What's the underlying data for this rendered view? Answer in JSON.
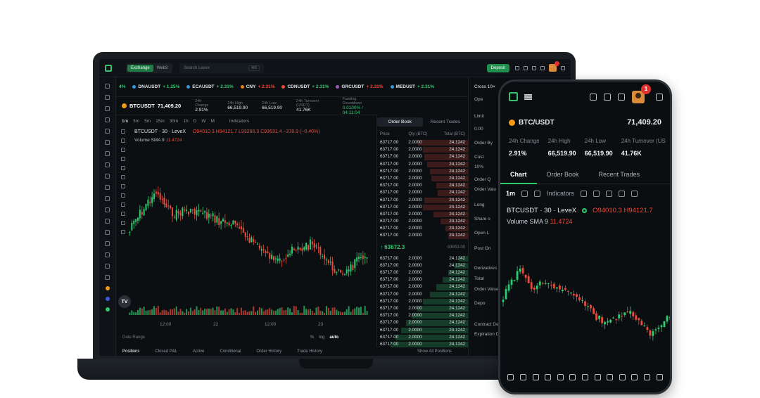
{
  "laptop": {
    "topbar": {
      "modes": [
        "Exchange",
        "Web3"
      ],
      "search_placeholder": "Search Levex",
      "search_shortcut": "⌘K",
      "deposit_label": "Deposit"
    },
    "tickers": [
      {
        "prefix": "4%",
        "symbol": "",
        "change": ""
      },
      {
        "symbol": "DNAUSDT",
        "change": "+ 1.25%",
        "color": "#3498db"
      },
      {
        "symbol": "ECAUSDT",
        "change": "+ 2.31%",
        "color": "#3498db"
      },
      {
        "symbol": "CNY",
        "change": "+ 2.31%",
        "color": "#e67e22"
      },
      {
        "symbol": "CDNUSDT",
        "change": "+ 2.31%",
        "color": "#e74c3c"
      },
      {
        "symbol": "GRCUSDT",
        "change": "+ 2.31%",
        "color": "#9b59b6"
      },
      {
        "symbol": "MEDUST",
        "change": "+ 2.31%",
        "color": "#3498db"
      }
    ],
    "pair": {
      "name": "BTCUSDT",
      "price": "71,409.20",
      "stats": [
        {
          "label": "24h Change",
          "value": "2.91%"
        },
        {
          "label": "24h High",
          "value": "66,519.90"
        },
        {
          "label": "24h Low",
          "value": "66,519.90"
        },
        {
          "label": "24h Turnover (USDT)",
          "value": "41.76K"
        },
        {
          "label": "Funding Countdown",
          "value": "0.0100% / 04:11:04"
        }
      ]
    },
    "timeframes": [
      "1m",
      "3m",
      "5m",
      "15m",
      "30m",
      "1h",
      "D",
      "W",
      "M"
    ],
    "indicators_label": "Indicators",
    "chart": {
      "title": "BTCUSDT · 30 · LeveX",
      "ohlc": "O94010.3  H94121.7  L93266.3  C93631.4  −378.9 (−0.40%)",
      "volume_label": "Volume SMA 9",
      "volume_value": "11.4724",
      "x_ticks": [
        "12:00",
        "22",
        "12:00",
        "23"
      ],
      "date_range_label": "Date Range",
      "scale_opts": [
        "%",
        "log",
        "auto"
      ]
    },
    "bottom_tabs": [
      "Positions",
      "Closed P&L",
      "Active",
      "Conditional",
      "Order History",
      "Trade History"
    ],
    "show_all_label": "Show All Positions",
    "orderbook": {
      "tabs": [
        "Order Book",
        "Recent Trades"
      ],
      "headers": [
        "Price",
        "Qty (BTC)",
        "Total (BTC)"
      ],
      "asks": [
        {
          "price": "63717.00",
          "qty": "2.0000",
          "total": "24.1242",
          "depth": 0.55
        },
        {
          "price": "63717.00",
          "qty": "2.0000",
          "total": "24.1242",
          "depth": 0.5
        },
        {
          "price": "63717.00",
          "qty": "2.0000",
          "total": "24.1242",
          "depth": 0.48
        },
        {
          "price": "63717.00",
          "qty": "2.0000",
          "total": "24.1242",
          "depth": 0.45
        },
        {
          "price": "63717.00",
          "qty": "2.0000",
          "total": "24.1242",
          "depth": 0.42
        },
        {
          "price": "63717.00",
          "qty": "2.0000",
          "total": "24.1242",
          "depth": 0.4
        },
        {
          "price": "63717.00",
          "qty": "2.0000",
          "total": "24.1242",
          "depth": 0.35
        },
        {
          "price": "63717.00",
          "qty": "2.0000",
          "total": "24.1242",
          "depth": 0.33
        },
        {
          "price": "63717.00",
          "qty": "2.0000",
          "total": "24.1242",
          "depth": 0.48
        },
        {
          "price": "63717.00",
          "qty": "2.0000",
          "total": "24.1242",
          "depth": 0.5
        },
        {
          "price": "63717.00",
          "qty": "2.0000",
          "total": "24.1242",
          "depth": 0.38
        },
        {
          "price": "63717.00",
          "qty": "2.0000",
          "total": "24.1242",
          "depth": 0.3
        },
        {
          "price": "63717.00",
          "qty": "2.0000",
          "total": "24.1242",
          "depth": 0.25
        },
        {
          "price": "63717.00",
          "qty": "2.0000",
          "total": "24.1242",
          "depth": 0.22
        }
      ],
      "mid_price": "↑ 63672.3",
      "mid_sub": "63853.00",
      "bids": [
        {
          "price": "63717.00",
          "qty": "2.0000",
          "total": "24.1242",
          "depth": 0.1
        },
        {
          "price": "63717.00",
          "qty": "2.0000",
          "total": "24.1242",
          "depth": 0.15
        },
        {
          "price": "63717.00",
          "qty": "2.0000",
          "total": "24.1242",
          "depth": 0.22
        },
        {
          "price": "63717.00",
          "qty": "2.0000",
          "total": "24.1242",
          "depth": 0.28
        },
        {
          "price": "63717.00",
          "qty": "2.0000",
          "total": "24.1242",
          "depth": 0.35
        },
        {
          "price": "63717.00",
          "qty": "2.0000",
          "total": "24.1242",
          "depth": 0.42
        },
        {
          "price": "63717.00",
          "qty": "2.0000",
          "total": "24.1242",
          "depth": 0.5
        },
        {
          "price": "63717.00",
          "qty": "2.0000",
          "total": "24.1242",
          "depth": 0.56
        },
        {
          "price": "63717.00",
          "qty": "2.0000",
          "total": "24.1242",
          "depth": 0.62
        },
        {
          "price": "63717.00",
          "qty": "2.0000",
          "total": "24.1242",
          "depth": 0.68
        },
        {
          "price": "63717.00",
          "qty": "2.0000",
          "total": "24.1242",
          "depth": 0.74
        },
        {
          "price": "63717.00",
          "qty": "2.0000",
          "total": "24.1242",
          "depth": 0.8
        },
        {
          "price": "63717.00",
          "qty": "2.0000",
          "total": "24.1242",
          "depth": 0.85
        }
      ]
    },
    "trade_panel": {
      "cross": "Cross 10×",
      "items": [
        "Ope",
        "Limit",
        "0.00",
        "Order By",
        "Cost",
        "10%",
        "Order Q",
        "Order Valu",
        "Long",
        "Share o",
        "Open L",
        "Post On",
        "Derivatives",
        "Total",
        "Order Value",
        "Depo",
        "Contract De",
        "Expiration D"
      ]
    }
  },
  "phone": {
    "pair": "BTC/USDT",
    "price": "71,409.20",
    "notif_count": "1",
    "stats": [
      {
        "label": "24h Change",
        "value": "2.91%"
      },
      {
        "label": "24h High",
        "value": "66,519.90"
      },
      {
        "label": "24h Low",
        "value": "66,519.90"
      },
      {
        "label": "24h Turnover (US",
        "value": "41.76K"
      }
    ],
    "tabs": [
      "Chart",
      "Order Book",
      "Recent Trades"
    ],
    "timeframe": "1m",
    "indicators_label": "Indicators",
    "chart_title": "BTCUSDT · 30 · LeveX",
    "ohlc": "O94010.3  H94121.7",
    "volume_label": "Volume SMA 9",
    "volume_value": "11.4724"
  }
}
